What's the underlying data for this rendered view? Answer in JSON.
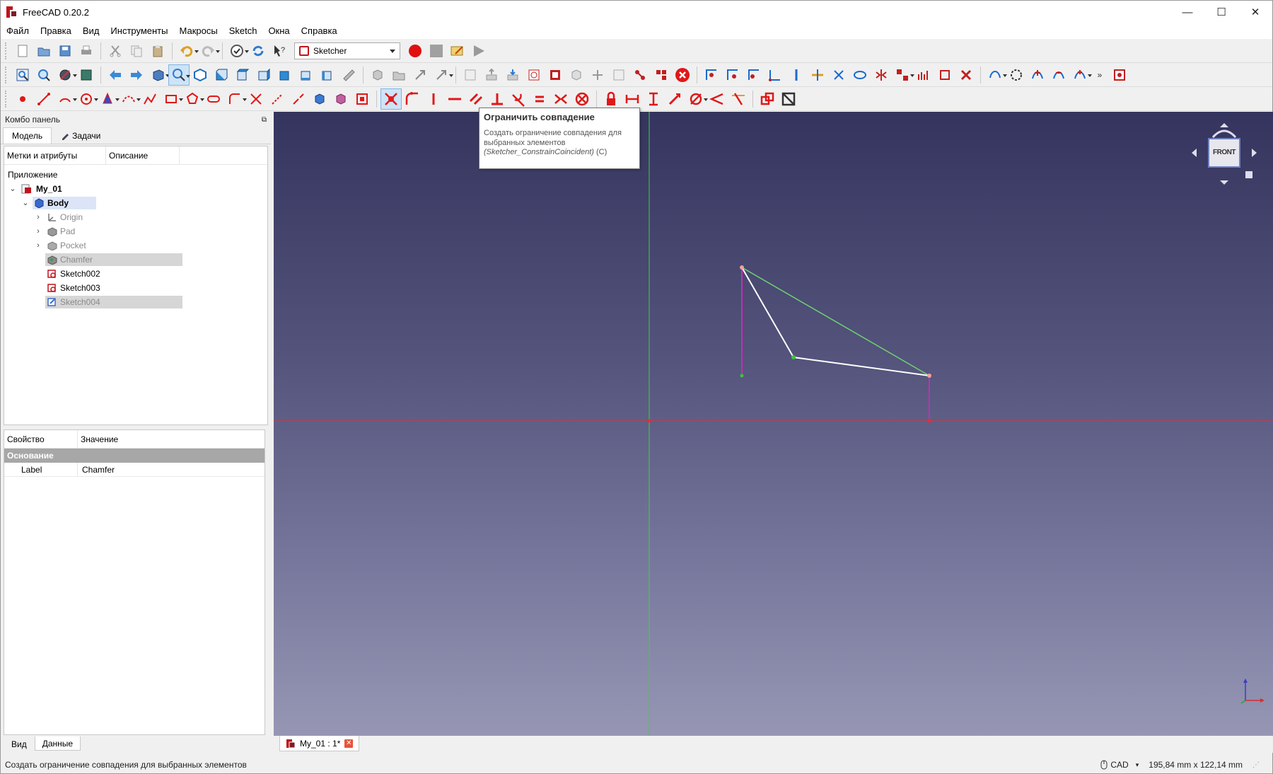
{
  "window": {
    "title": "FreeCAD 0.20.2",
    "minimize": "—",
    "maximize": "☐",
    "close": "✕"
  },
  "menu": [
    "Файл",
    "Правка",
    "Вид",
    "Инструменты",
    "Макросы",
    "Sketch",
    "Окна",
    "Справка"
  ],
  "toolbar": {
    "workbench": "Sketcher"
  },
  "combo": {
    "title": "Комбо панель",
    "tabs": [
      "Модель",
      "Задачи"
    ],
    "tree_headers": [
      "Метки и атрибуты",
      "Описание"
    ],
    "section": "Приложение",
    "items": [
      {
        "label": "My_01",
        "icon": "document-icon"
      },
      {
        "label": "Body",
        "icon": "body-icon"
      },
      {
        "label": "Origin",
        "icon": "origin-icon"
      },
      {
        "label": "Pad",
        "icon": "pad-icon"
      },
      {
        "label": "Pocket",
        "icon": "pocket-icon"
      },
      {
        "label": "Chamfer",
        "icon": "chamfer-icon"
      },
      {
        "label": "Sketch002",
        "icon": "sketch-icon"
      },
      {
        "label": "Sketch003",
        "icon": "sketch-icon"
      },
      {
        "label": "Sketch004",
        "icon": "sketch-icon"
      }
    ],
    "props_headers": [
      "Свойство",
      "Значение"
    ],
    "props_group": "Основание",
    "props_rows": [
      {
        "key": "Label",
        "value": "Chamfer"
      }
    ],
    "bottom_tabs": [
      "Вид",
      "Данные"
    ]
  },
  "tooltip": {
    "title": "Ограничить совпадение",
    "body": "Создать ограничение совпадения для выбранных элементов",
    "command": "(Sketcher_ConstrainCoincident)",
    "shortcut": "(C)"
  },
  "navcube": {
    "face": "FRONT"
  },
  "doc_tab": {
    "label": "My_01 : 1*"
  },
  "status": {
    "message": "Создать ограничение совпадения для выбранных элементов",
    "nav_style": "CAD",
    "dimensions": "195,84 mm x 122,14 mm"
  },
  "colors": {
    "axis_x": "#e53030",
    "axis_y": "#40d040",
    "construction": "#c030b0",
    "geometry": "#ffffff",
    "selected_line": "#70d070",
    "viewport_top": "#34345e",
    "viewport_bottom": "#9696b4"
  }
}
